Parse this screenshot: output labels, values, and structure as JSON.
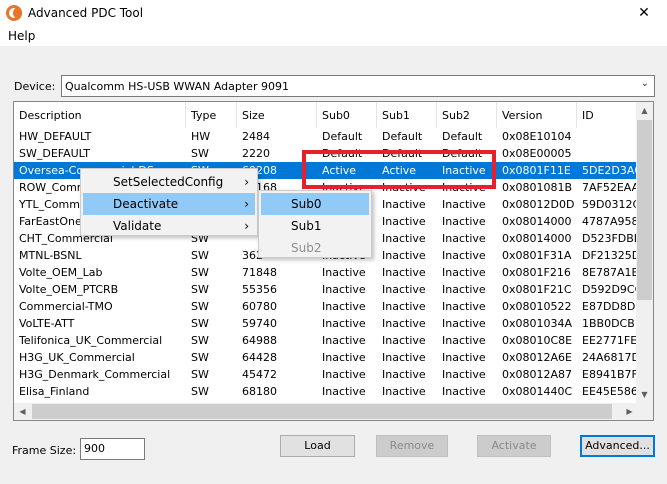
{
  "window": {
    "title": "Advanced PDC Tool",
    "close_glyph": "✕"
  },
  "menu": {
    "help": "Help"
  },
  "device": {
    "label": "Device:",
    "value": "Qualcomm HS-USB WWAN Adapter 9091"
  },
  "columns": [
    "Description",
    "Type",
    "Size",
    "Sub0",
    "Sub1",
    "Sub2",
    "Version",
    "ID"
  ],
  "rows": [
    {
      "description": "HW_DEFAULT",
      "type": "HW",
      "size": "2484",
      "sub0": "Default",
      "sub1": "Default",
      "sub2": "Default",
      "version": "0x08E10104",
      "id": ""
    },
    {
      "description": "SW_DEFAULT",
      "type": "SW",
      "size": "2220",
      "sub0": "Default",
      "sub1": "Default",
      "sub2": "Default",
      "version": "0x08E00005",
      "id": ""
    },
    {
      "description": "Oversea-Commercial-DS",
      "type": "SW",
      "size": "69208",
      "sub0": "Active",
      "sub1": "Active",
      "sub2": "Inactive",
      "version": "0x0801F11E",
      "id": "5DE2D3A0...",
      "selected": true
    },
    {
      "description": "ROW_Commercial",
      "type": "SW",
      "size": "63168",
      "sub0": "Inactive",
      "sub1": "Inactive",
      "sub2": "Inactive",
      "version": "0x0801081B",
      "id": "7AF52EAA..."
    },
    {
      "description": "YTL_Commercial",
      "type": "SW",
      "size": "",
      "sub0": "Inactive",
      "sub1": "Inactive",
      "sub2": "Inactive",
      "version": "0x08012D0D",
      "id": "59D0312C..."
    },
    {
      "description": "FarEastOne",
      "type": "SW",
      "size": "",
      "sub0": "Inactive",
      "sub1": "Inactive",
      "sub2": "Inactive",
      "version": "0x08014000",
      "id": "4787A9589..."
    },
    {
      "description": "CHT_Commercial",
      "type": "SW",
      "size": "",
      "sub0": "Inactive",
      "sub1": "Inactive",
      "sub2": "Inactive",
      "version": "0x08014000",
      "id": "D523FDBE..."
    },
    {
      "description": "MTNL-BSNL",
      "type": "SW",
      "size": "362",
      "sub0": "Inactive",
      "sub1": "Inactive",
      "sub2": "Inactive",
      "version": "0x0801F31A",
      "id": "DF21325D3..."
    },
    {
      "description": "Volte_OEM_Lab",
      "type": "SW",
      "size": "71848",
      "sub0": "Inactive",
      "sub1": "Inactive",
      "sub2": "Inactive",
      "version": "0x0801F216",
      "id": "8E787A1EB..."
    },
    {
      "description": "Volte_OEM_PTCRB",
      "type": "SW",
      "size": "55356",
      "sub0": "Inactive",
      "sub1": "Inactive",
      "sub2": "Inactive",
      "version": "0x0801F21C",
      "id": "D592D9CC..."
    },
    {
      "description": "Commercial-TMO",
      "type": "SW",
      "size": "60780",
      "sub0": "Inactive",
      "sub1": "Inactive",
      "sub2": "Inactive",
      "version": "0x08010522",
      "id": "E87DD8D6..."
    },
    {
      "description": "VoLTE-ATT",
      "type": "SW",
      "size": "59740",
      "sub0": "Inactive",
      "sub1": "Inactive",
      "sub2": "Inactive",
      "version": "0x0801034A",
      "id": "1BB0DCB1B..."
    },
    {
      "description": "Telifonica_UK_Commercial",
      "type": "SW",
      "size": "64988",
      "sub0": "Inactive",
      "sub1": "Inactive",
      "sub2": "Inactive",
      "version": "0x08010C8E",
      "id": "EE2771FE1..."
    },
    {
      "description": "H3G_UK_Commercial",
      "type": "SW",
      "size": "64428",
      "sub0": "Inactive",
      "sub1": "Inactive",
      "sub2": "Inactive",
      "version": "0x08012A6E",
      "id": "24A6817D2..."
    },
    {
      "description": "H3G_Denmark_Commercial",
      "type": "SW",
      "size": "45472",
      "sub0": "Inactive",
      "sub1": "Inactive",
      "sub2": "Inactive",
      "version": "0x08012A87",
      "id": "E8941B7FC..."
    },
    {
      "description": "Elisa_Finland",
      "type": "SW",
      "size": "68180",
      "sub0": "Inactive",
      "sub1": "Inactive",
      "sub2": "Inactive",
      "version": "0x0801440C",
      "id": "EE45E5869..."
    }
  ],
  "context_menu": {
    "items": [
      {
        "label": "SetSelectedConfig",
        "arrow": "›"
      },
      {
        "label": "Deactivate",
        "arrow": "›"
      },
      {
        "label": "Validate",
        "arrow": "›"
      }
    ]
  },
  "submenu": {
    "items": [
      {
        "label": "Sub0"
      },
      {
        "label": "Sub1"
      },
      {
        "label": "Sub2"
      }
    ]
  },
  "footer": {
    "frame_size_label": "Frame Size:",
    "frame_size_value": "900",
    "load": "Load",
    "remove": "Remove",
    "activate": "Activate",
    "advanced": "Advanced..."
  },
  "scroll_glyphs": {
    "up": "▲",
    "down": "▼",
    "left": "◀",
    "right": "▶"
  },
  "colors": {
    "selection": "#0078d7",
    "highlight_box": "#e8202a",
    "menu_hover": "#91c9f7"
  }
}
